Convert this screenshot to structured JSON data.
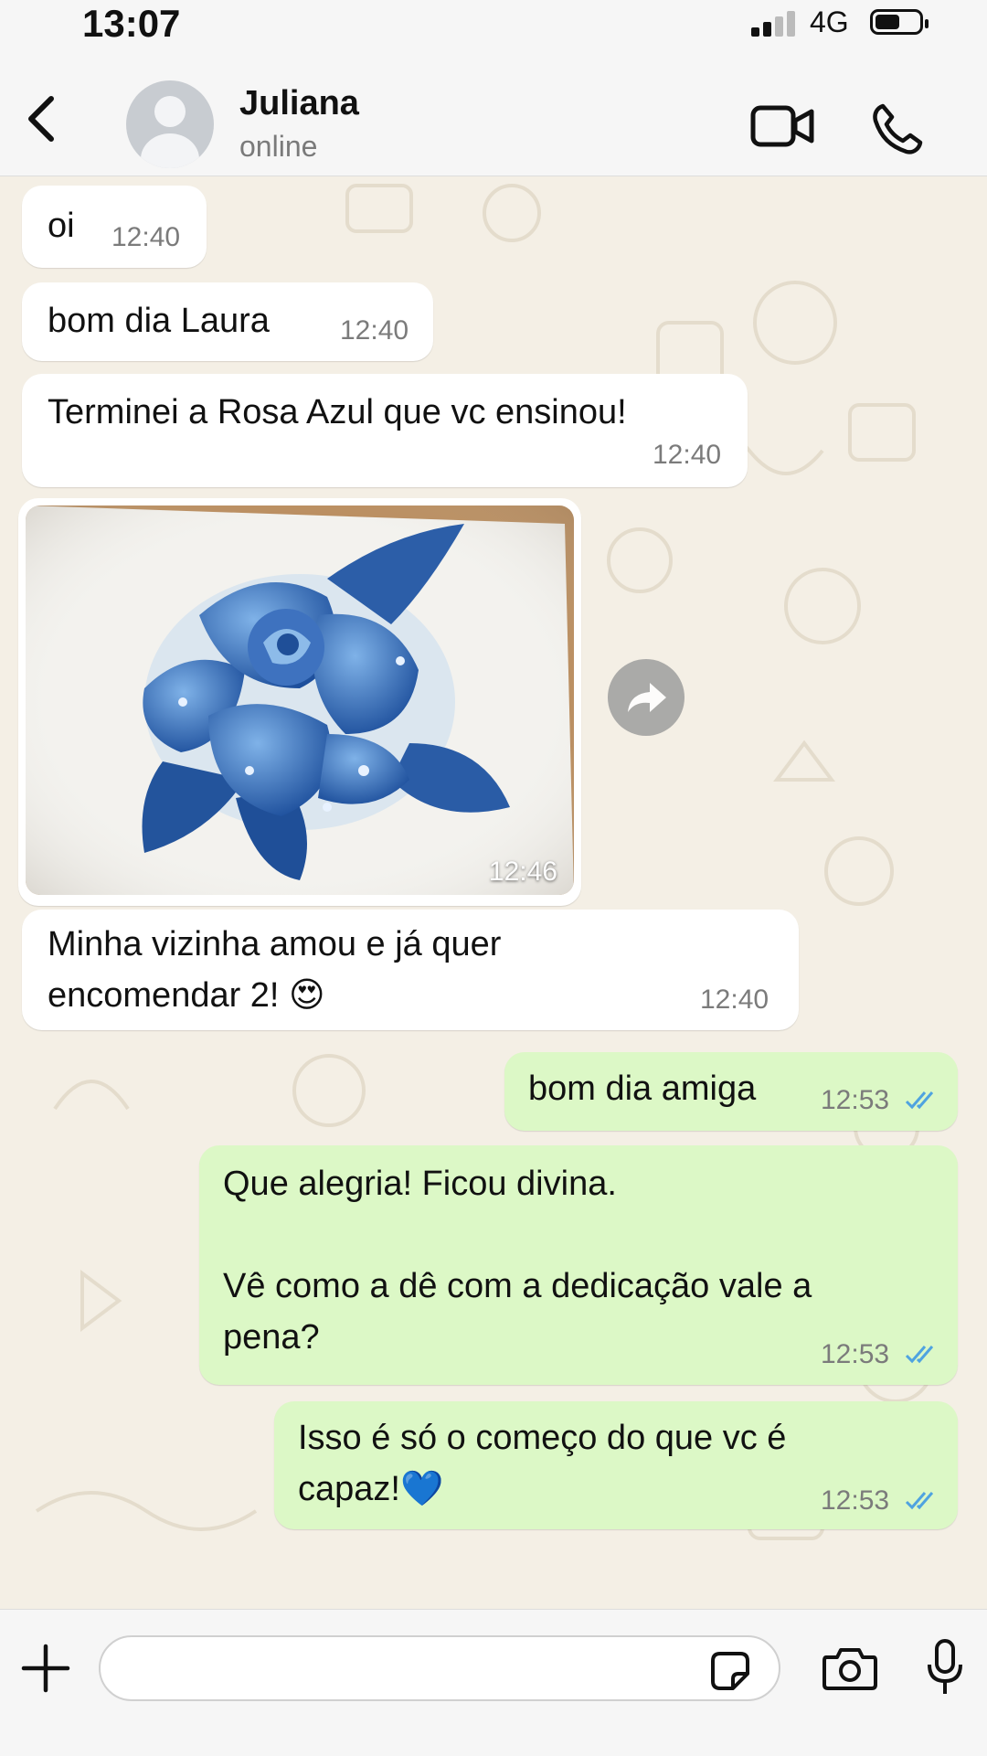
{
  "status_bar": {
    "time": "13:07",
    "network": "4G",
    "signal_icon": "signal-bars-icon",
    "battery_icon": "battery-icon"
  },
  "header": {
    "back_icon": "chevron-left-icon",
    "contact_name": "Juliana",
    "contact_status": "online",
    "video_call_icon": "video-camera-icon",
    "voice_call_icon": "phone-icon"
  },
  "messages": [
    {
      "direction": "in",
      "text": "oi",
      "time": "12:40"
    },
    {
      "direction": "in",
      "text": "bom dia Laura",
      "time": "12:40"
    },
    {
      "direction": "in",
      "text": "Terminei a Rosa Azul que vc ensinou!",
      "time": "12:40"
    },
    {
      "direction": "in",
      "type": "image",
      "image_subject": "blue rose drawing",
      "time": "12:46"
    },
    {
      "direction": "in",
      "text": "Minha vizinha amou e já quer\nencomendar 2! 😍",
      "time": "12:40"
    },
    {
      "direction": "out",
      "text": "bom dia amiga",
      "time": "12:53",
      "status": "read"
    },
    {
      "direction": "out",
      "text": "Que alegria! Ficou divina.\n\nVê como a dê com a dedicação vale a\npena?",
      "time": "12:53",
      "status": "read"
    },
    {
      "direction": "out",
      "text": "Isso é só o começo do que vc é\ncapaz!💙",
      "time": "12:53",
      "status": "read"
    }
  ],
  "forward_icon": "forward-arrow-icon",
  "input_bar": {
    "attach_icon": "plus-icon",
    "message_value": "",
    "sticker_icon": "sticker-icon",
    "camera_icon": "camera-icon",
    "mic_icon": "microphone-icon"
  },
  "colors": {
    "incoming_bubble": "#ffffff",
    "outgoing_bubble": "#dcf8c6",
    "chat_background": "#f4efe5",
    "read_ticks": "#4fa3e0"
  }
}
